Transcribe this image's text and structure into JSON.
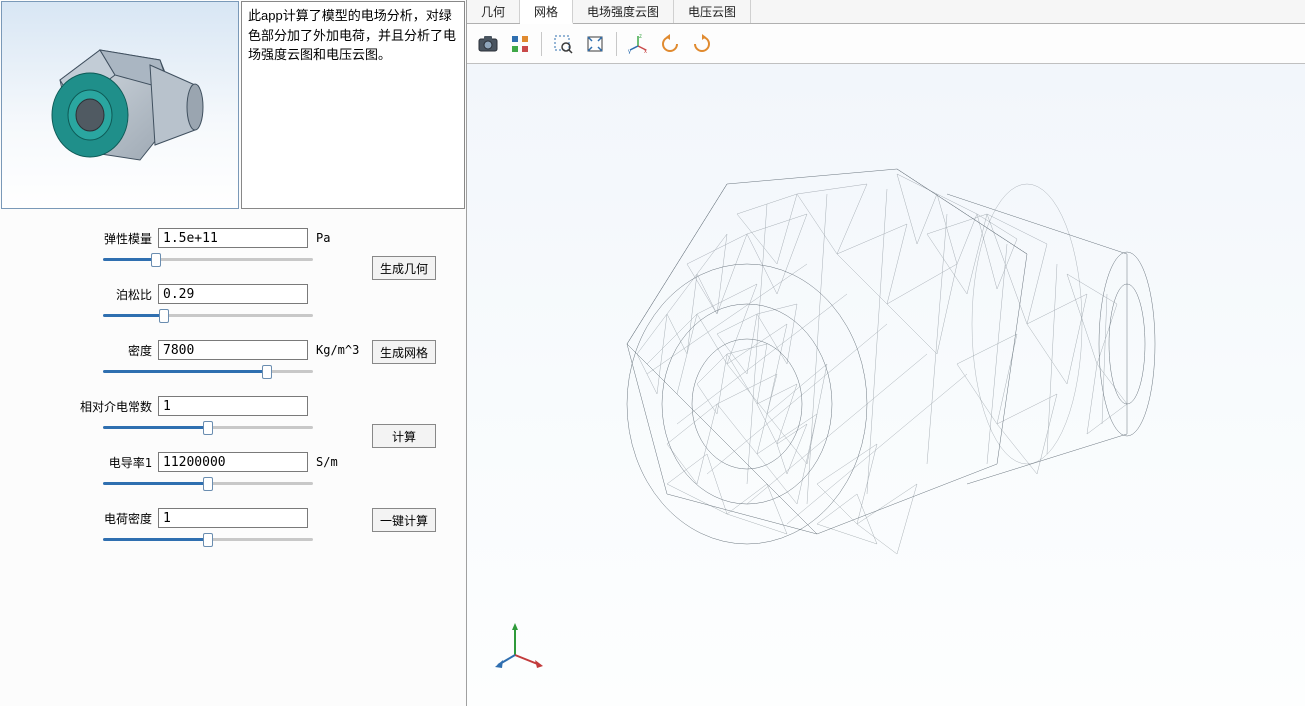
{
  "description": "此app计算了模型的电场分析，对绿色部分加了外加电荷，并且分析了电场强度云图和电压云图。",
  "fields": {
    "elastic_modulus": {
      "label": "弹性模量",
      "value": "1.5e+11",
      "unit": "Pa",
      "slider_pct": 25
    },
    "poisson_ratio": {
      "label": "泊松比",
      "value": "0.29",
      "unit": "",
      "slider_pct": 29
    },
    "density": {
      "label": "密度",
      "value": "7800",
      "unit": "Kg/m^3",
      "slider_pct": 78
    },
    "rel_permittivity": {
      "label": "相对介电常数",
      "value": "1",
      "unit": "",
      "slider_pct": 50
    },
    "conductivity1": {
      "label": "电导率1",
      "value": "11200000",
      "unit": "S/m",
      "slider_pct": 50
    },
    "charge_density": {
      "label": "电荷密度",
      "value": "1",
      "unit": "",
      "slider_pct": 50
    }
  },
  "buttons": {
    "gen_geometry": "生成几何",
    "gen_mesh": "生成网格",
    "compute": "计算",
    "compute_all": "一键计算"
  },
  "tabs": {
    "geometry": "几何",
    "mesh": "网格",
    "efield_plot": "电场强度云图",
    "voltage_plot": "电压云图"
  },
  "toolbar_icons": {
    "screenshot": "screenshot-icon",
    "select_mode": "select-mode-icon",
    "zoom_window": "zoom-window-icon",
    "zoom_extents": "zoom-extents-icon",
    "axis_toggle": "axis-toggle-icon",
    "rotate_ccw": "rotate-ccw-icon",
    "rotate_cw": "rotate-cw-icon"
  },
  "colors": {
    "accent": "#2f6fb0",
    "teal": "#1f8f8a",
    "orange": "#e08a2f"
  }
}
